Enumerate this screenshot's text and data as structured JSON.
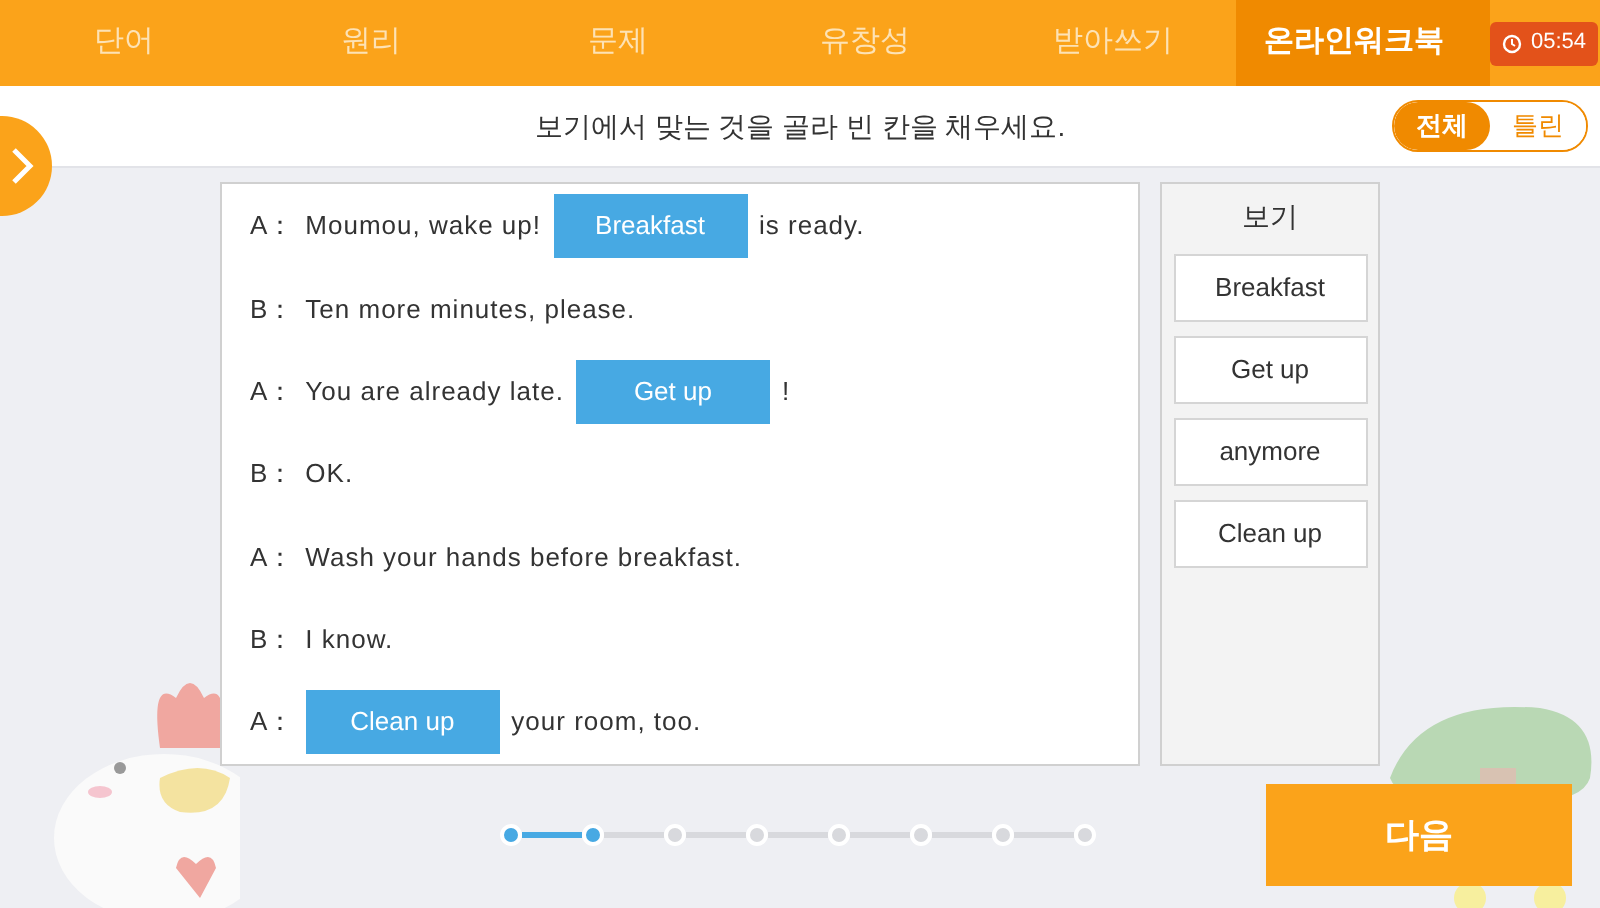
{
  "tabs": [
    {
      "label": "단어",
      "selected": false
    },
    {
      "label": "원리",
      "selected": false
    },
    {
      "label": "문제",
      "selected": false
    },
    {
      "label": "유창성",
      "selected": false
    },
    {
      "label": "받아쓰기",
      "selected": false
    },
    {
      "label": "온라인워크북",
      "selected": true
    }
  ],
  "timer": "05:54",
  "instruction": "보기에서 맞는 것을 골라 빈 칸을 채우세요.",
  "filter": [
    {
      "label": "전체",
      "selected": true
    },
    {
      "label": "틀린",
      "selected": false
    }
  ],
  "dialogue": [
    {
      "speaker": "A：",
      "parts": [
        {
          "kind": "text",
          "text": "Moumou, wake up!"
        },
        {
          "kind": "blank",
          "text": "Breakfast"
        },
        {
          "kind": "text",
          "text": "is ready."
        }
      ]
    },
    {
      "speaker": "B：",
      "parts": [
        {
          "kind": "text",
          "text": "Ten more minutes, please."
        }
      ]
    },
    {
      "speaker": "A：",
      "parts": [
        {
          "kind": "text",
          "text": "You are already late."
        },
        {
          "kind": "blank",
          "text": "Get up"
        },
        {
          "kind": "text",
          "text": "!"
        }
      ]
    },
    {
      "speaker": "B：",
      "parts": [
        {
          "kind": "text",
          "text": "OK."
        }
      ]
    },
    {
      "speaker": "A：",
      "parts": [
        {
          "kind": "text",
          "text": "Wash your hands before breakfast."
        }
      ]
    },
    {
      "speaker": "B：",
      "parts": [
        {
          "kind": "text",
          "text": "I know."
        }
      ]
    },
    {
      "speaker": "A：",
      "parts": [
        {
          "kind": "blank",
          "text": "Clean up"
        },
        {
          "kind": "text",
          "text": "your room, too."
        }
      ]
    }
  ],
  "word_bank": {
    "title": "보기",
    "words": [
      "Breakfast",
      "Get up",
      "anymore",
      "Clean up"
    ]
  },
  "pages": [
    {
      "selected": true
    },
    {
      "selected": true
    },
    {
      "selected": false
    },
    {
      "selected": false
    },
    {
      "selected": false
    },
    {
      "selected": false
    },
    {
      "selected": false
    },
    {
      "selected": false
    }
  ],
  "next_button": "다음"
}
